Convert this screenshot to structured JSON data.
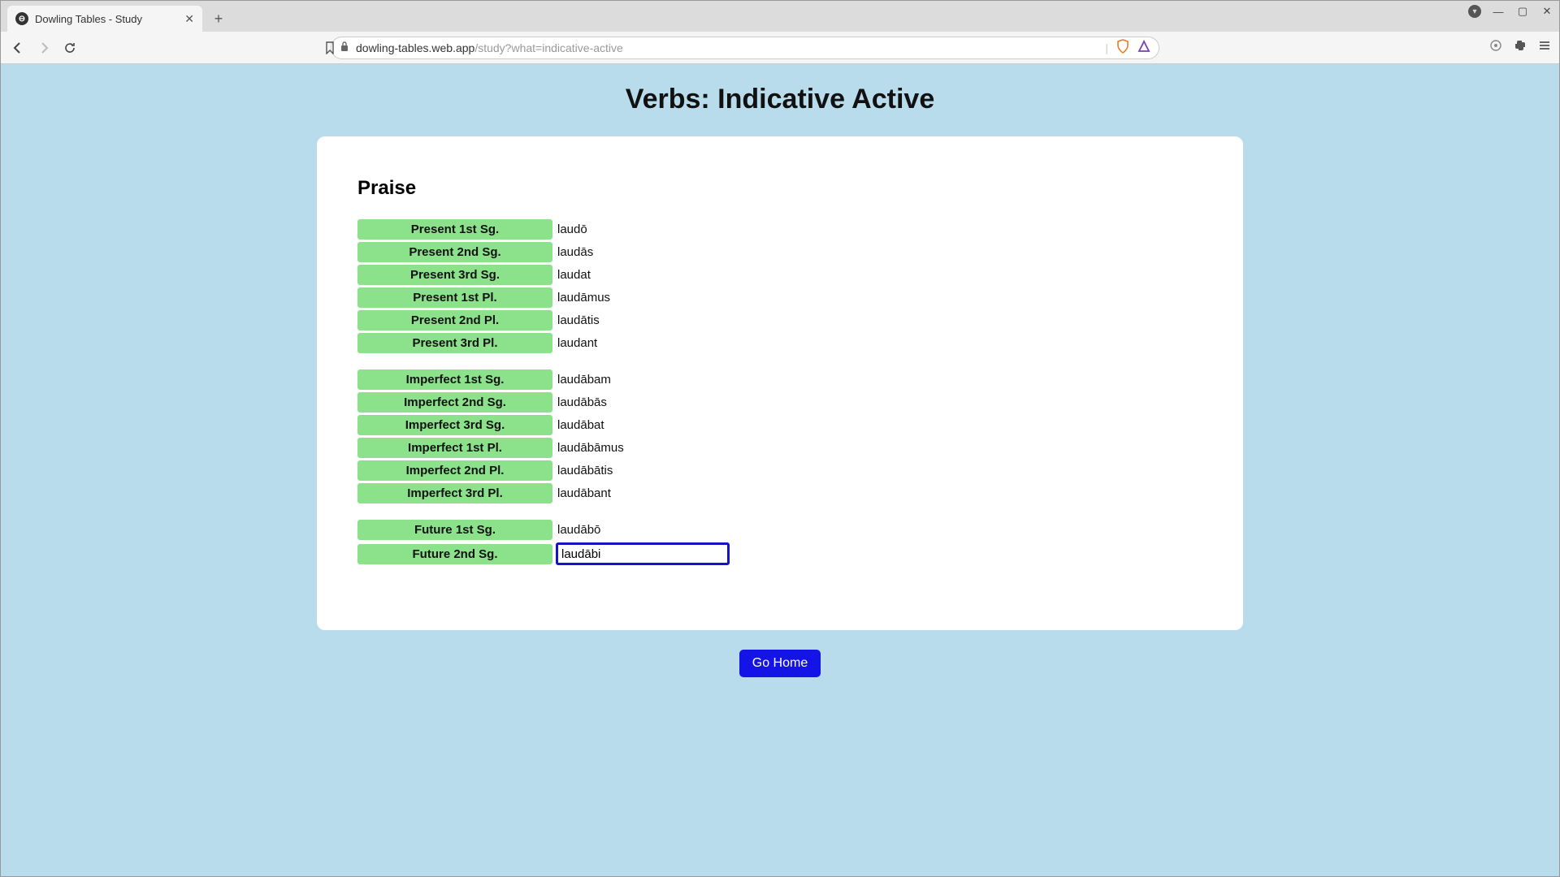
{
  "browser": {
    "tab_title": "Dowling Tables - Study",
    "url_domain": "dowling-tables.web.app",
    "url_path": "/study?what=indicative-active"
  },
  "page": {
    "title": "Verbs: Indicative Active",
    "card_heading": "Praise",
    "go_home_label": "Go Home",
    "input_value": "laudābi",
    "groups": [
      {
        "rows": [
          {
            "label": "Present 1st Sg.",
            "value": "laudō"
          },
          {
            "label": "Present 2nd Sg.",
            "value": "laudās"
          },
          {
            "label": "Present 3rd Sg.",
            "value": "laudat"
          },
          {
            "label": "Present 1st Pl.",
            "value": "laudāmus"
          },
          {
            "label": "Present 2nd Pl.",
            "value": "laudātis"
          },
          {
            "label": "Present 3rd Pl.",
            "value": "laudant"
          }
        ]
      },
      {
        "rows": [
          {
            "label": "Imperfect 1st Sg.",
            "value": "laudābam"
          },
          {
            "label": "Imperfect 2nd Sg.",
            "value": "laudābās"
          },
          {
            "label": "Imperfect 3rd Sg.",
            "value": "laudābat"
          },
          {
            "label": "Imperfect 1st Pl.",
            "value": "laudābāmus"
          },
          {
            "label": "Imperfect 2nd Pl.",
            "value": "laudābātis"
          },
          {
            "label": "Imperfect 3rd Pl.",
            "value": "laudābant"
          }
        ]
      },
      {
        "rows": [
          {
            "label": "Future 1st Sg.",
            "value": "laudābō"
          },
          {
            "label": "Future 2nd Sg.",
            "input": true
          }
        ]
      }
    ]
  }
}
